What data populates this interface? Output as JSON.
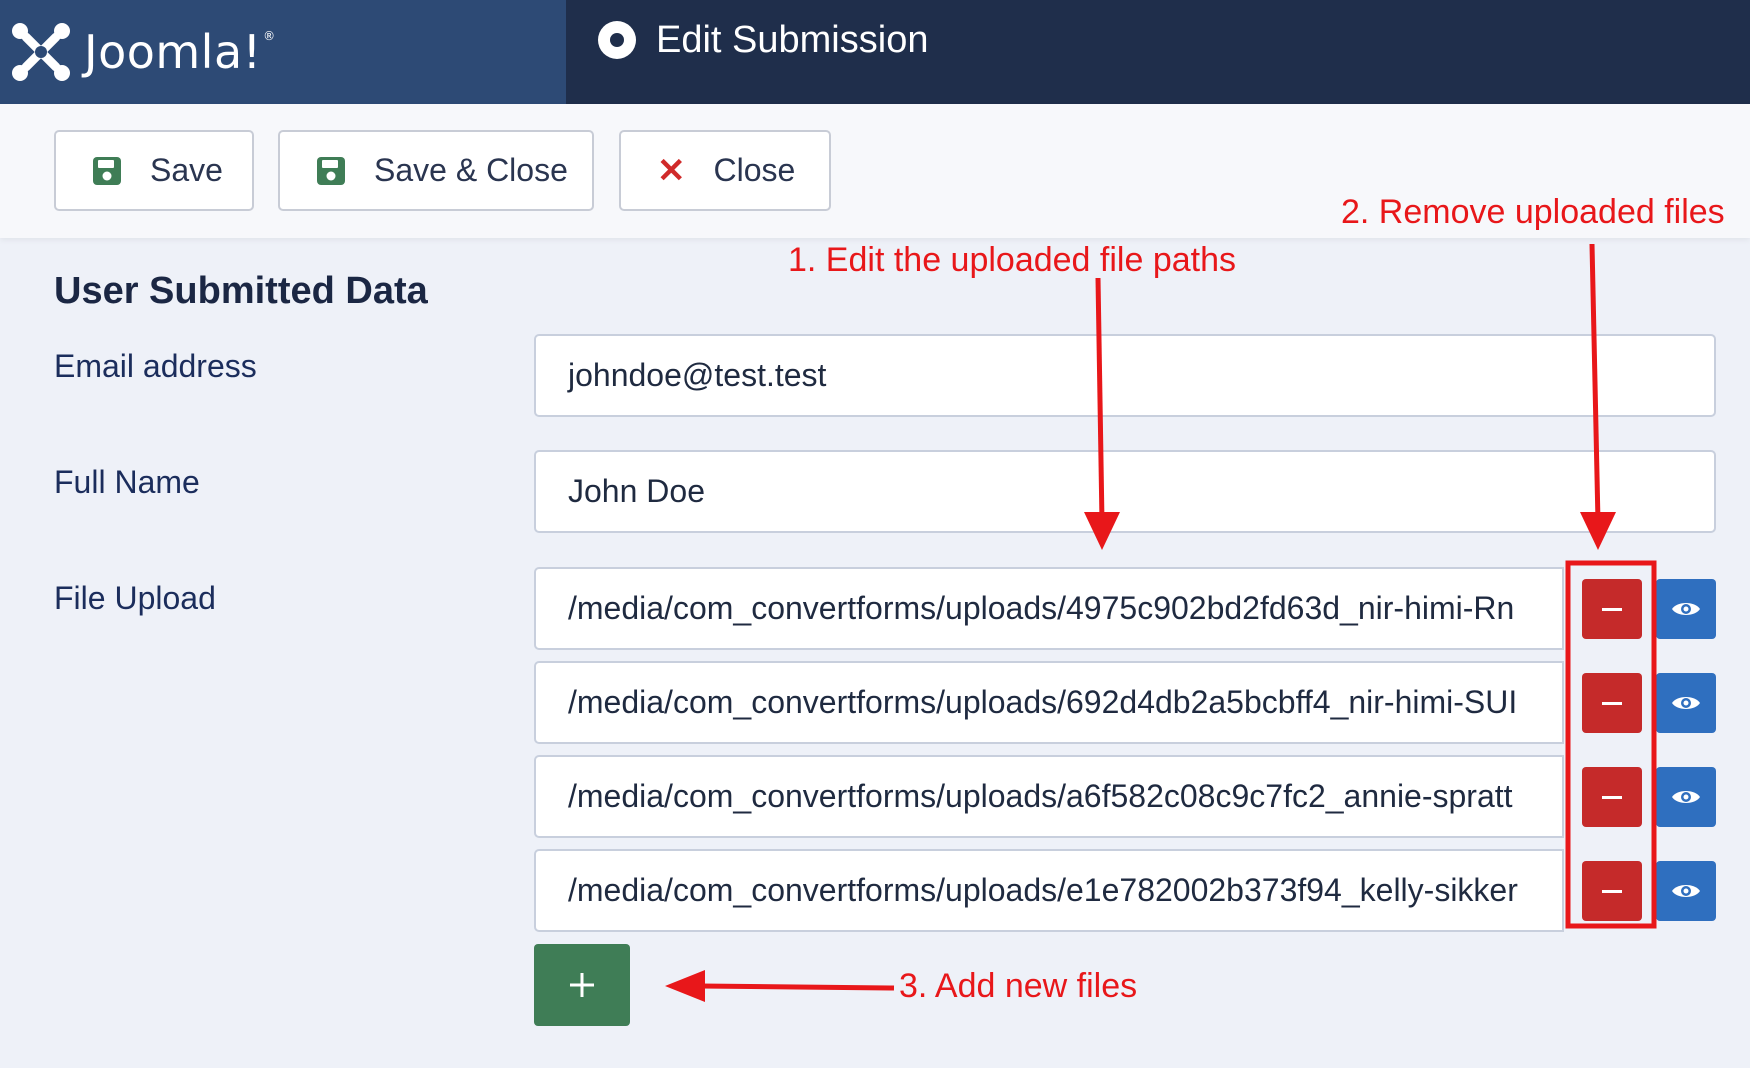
{
  "header": {
    "brand_name": "Joomla!",
    "brand_mark": "®",
    "title": "Edit Submission",
    "title_icon": "dot-circle-icon"
  },
  "toolbar": {
    "save_label": "Save",
    "save_close_label": "Save & Close",
    "close_label": "Close"
  },
  "form": {
    "section_title": "User Submitted Data",
    "email_label": "Email address",
    "email_value": "johndoe@test.test",
    "name_label": "Full Name",
    "name_value": "John Doe",
    "file_label": "File Upload",
    "files": [
      "/media/com_convertforms/uploads/4975c902bd2fd63d_nir-himi-Rn",
      "/media/com_convertforms/uploads/692d4db2a5bcbff4_nir-himi-SUI",
      "/media/com_convertforms/uploads/a6f582c08c9c7fc2_annie-spratt",
      "/media/com_convertforms/uploads/e1e782002b373f94_kelly-sikker"
    ]
  },
  "annotations": {
    "edit": "1. Edit the uploaded file paths",
    "remove": "2. Remove uploaded files",
    "add": "3. Add new files"
  },
  "colors": {
    "header_bg": "#1f2e4b",
    "brand_bg": "#2d4a75",
    "remove": "#c52a2a",
    "view": "#2f6fbf",
    "add": "#3f7d56",
    "save_icon": "#3f7d56",
    "annotation": "#e8171a"
  }
}
